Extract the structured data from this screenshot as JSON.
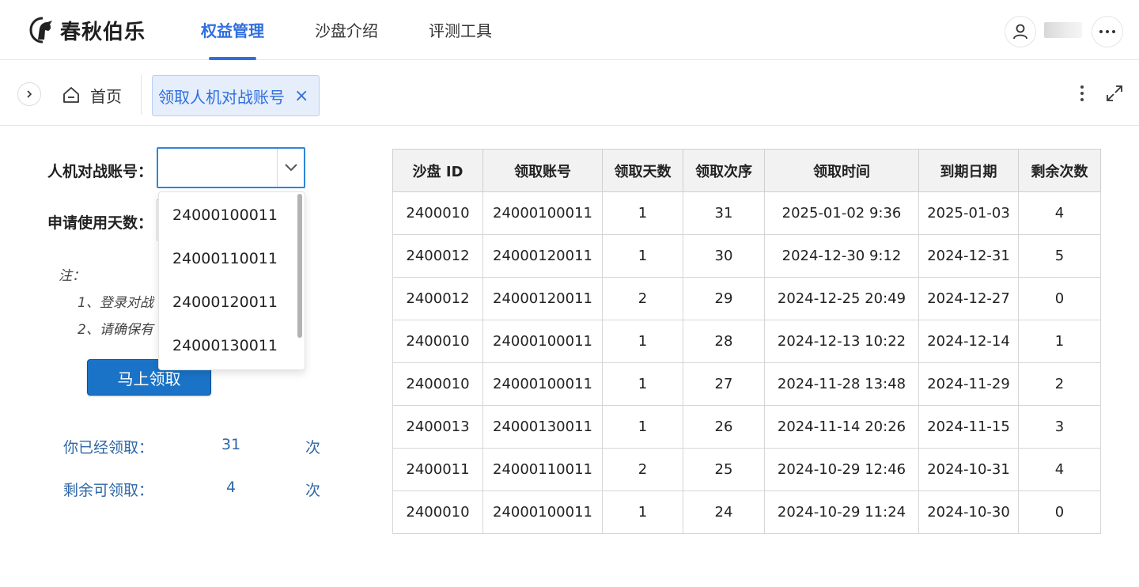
{
  "app": {
    "name": "春秋伯乐",
    "accent_color": "#2f6fde",
    "nav": [
      {
        "label": "权益管理",
        "active": true
      },
      {
        "label": "沙盘介绍",
        "active": false
      },
      {
        "label": "评测工具",
        "active": false
      }
    ],
    "icons": {
      "user": "user-icon",
      "more": "more-horizontal-icon"
    }
  },
  "tabs": {
    "home_label": "首页",
    "active_label": "领取人机对战账号",
    "close_glyph": "×"
  },
  "form": {
    "account_label": "人机对战账号：",
    "days_label": "申请使用天数：",
    "account_value": "",
    "dropdown_options": [
      "24000100011",
      "24000110011",
      "24000120011",
      "24000130011"
    ],
    "note_title": "注：",
    "note_line1": "1、登录对战",
    "note_line2": "2、请确保有",
    "claim_button": "马上领取"
  },
  "stats": {
    "claimed_label": "你已经领取：",
    "claimed_value": "31",
    "claimed_unit": "次",
    "remaining_label": "剩余可领取：",
    "remaining_value": "4",
    "remaining_unit": "次"
  },
  "table": {
    "headers": [
      "沙盘 ID",
      "领取账号",
      "领取天数",
      "领取次序",
      "领取时间",
      "到期日期",
      "剩余次数"
    ],
    "rows": [
      [
        "2400010",
        "24000100011",
        "1",
        "31",
        "2025-01-02 9:36",
        "2025-01-03",
        "4"
      ],
      [
        "2400012",
        "24000120011",
        "1",
        "30",
        "2024-12-30 9:12",
        "2024-12-31",
        "5"
      ],
      [
        "2400012",
        "24000120011",
        "2",
        "29",
        "2024-12-25 20:49",
        "2024-12-27",
        "0"
      ],
      [
        "2400010",
        "24000100011",
        "1",
        "28",
        "2024-12-13 10:22",
        "2024-12-14",
        "1"
      ],
      [
        "2400010",
        "24000100011",
        "1",
        "27",
        "2024-11-28 13:48",
        "2024-11-29",
        "2"
      ],
      [
        "2400013",
        "24000130011",
        "1",
        "26",
        "2024-11-14 20:26",
        "2024-11-15",
        "3"
      ],
      [
        "2400011",
        "24000110011",
        "2",
        "25",
        "2024-10-29 12:46",
        "2024-10-31",
        "4"
      ],
      [
        "2400010",
        "24000100011",
        "1",
        "24",
        "2024-10-29 11:24",
        "2024-10-30",
        "0"
      ]
    ]
  }
}
